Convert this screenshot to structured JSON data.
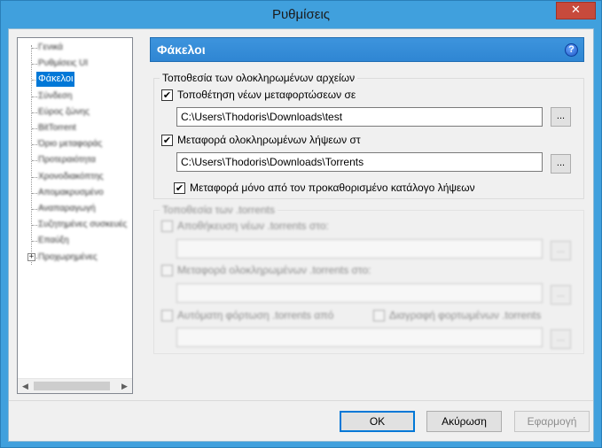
{
  "window": {
    "title": "Ρυθμίσεις",
    "close_glyph": "✕"
  },
  "tree": {
    "items": [
      {
        "label": "Γενικά"
      },
      {
        "label": "Ρυθμίσεις UI"
      },
      {
        "label": "Φάκελοι",
        "selected": true
      },
      {
        "label": "Σύνδεση"
      },
      {
        "label": "Εύρος ζώνης"
      },
      {
        "label": "BitTorrent"
      },
      {
        "label": "Όριο μεταφοράς"
      },
      {
        "label": "Προτεραιότητα"
      },
      {
        "label": "Χρονοδιακόπτης"
      },
      {
        "label": "Απομακρυσμένο"
      },
      {
        "label": "Αναπαραγωγή"
      },
      {
        "label": "Συζητημένες συσκευές"
      },
      {
        "label": "Επαύξη"
      },
      {
        "label": "Προχωρημένες"
      }
    ],
    "expander_glyph": "+",
    "scroll_left": "◀",
    "scroll_right": "▶"
  },
  "header": {
    "title": "Φάκελοι",
    "help_glyph": "?"
  },
  "completed": {
    "legend": "Τοποθεσία των ολοκληρωμένων αρχείων",
    "new_downloads": {
      "checked": true,
      "label": "Τοποθέτηση νέων μεταφορτώσεων σε",
      "path": "C:\\Users\\Thodoris\\Downloads\\test"
    },
    "move_completed": {
      "checked": true,
      "label": "Μεταφορά ολοκληρωμένων λήψεων στ",
      "path": "C:\\Users\\Thodoris\\Downloads\\Torrents"
    },
    "only_default": {
      "checked": true,
      "label": "Μεταφορά μόνο από τον προκαθορισμένο κατάλογο λήψεων"
    },
    "browse_label": "..."
  },
  "torrents": {
    "legend": "Τοποθεσία των .torrents",
    "store_torrents": {
      "label": "Αποθήκευση νέων .torrents στο:"
    },
    "move_completed_torrents": {
      "label": "Μεταφορά ολοκληρωμένων .torrents στο:"
    },
    "autoload": {
      "label": "Αυτόματη φόρτωση .torrents από"
    },
    "delete_loaded": {
      "label": "Διαγραφή φορτωμένων .torrents"
    },
    "browse_label": "..."
  },
  "buttons": {
    "ok": "OK",
    "cancel": "Ακύρωση",
    "apply": "Εφαρμογή"
  },
  "colors": {
    "title_bar": "#40a0dd",
    "header": "#3d94dd",
    "selection": "#0078d7",
    "close": "#c74a3c"
  },
  "check_glyph": "✔"
}
